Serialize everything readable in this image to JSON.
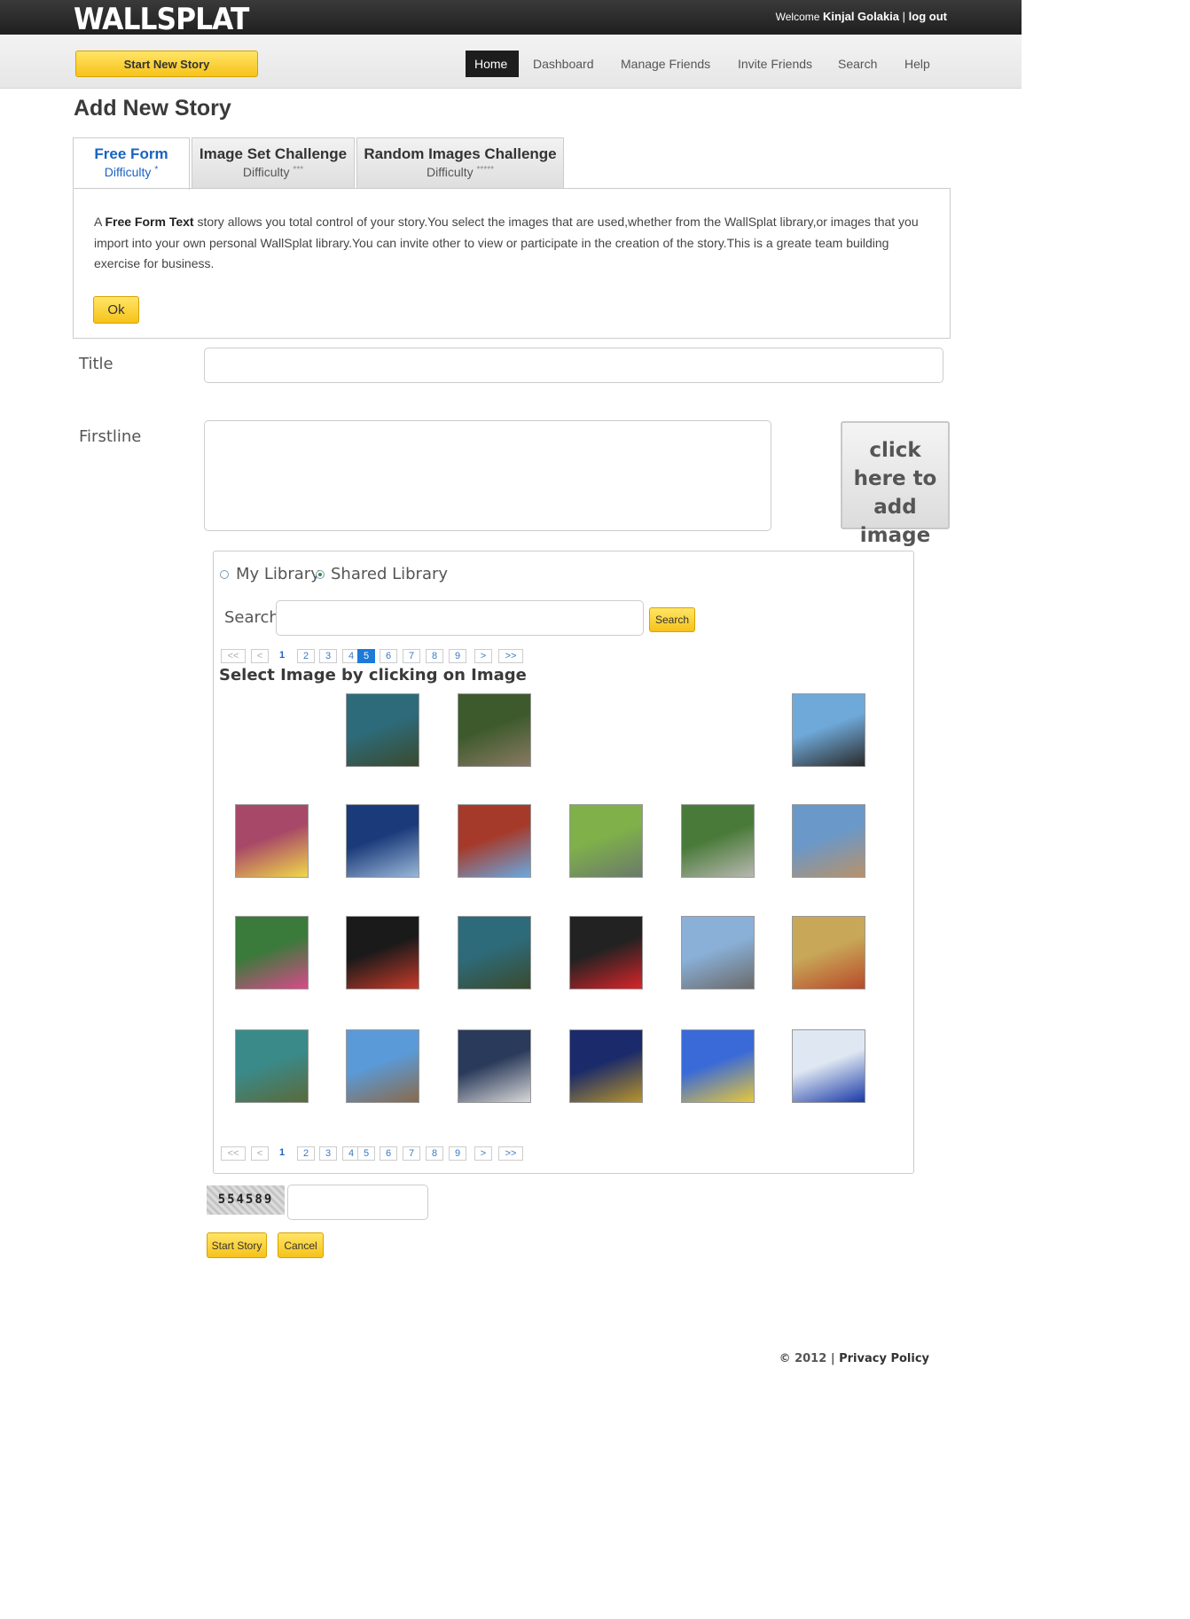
{
  "header": {
    "logo": "WALLSPLAT",
    "welcome": "Welcome",
    "user_name": "Kinjal Golakia",
    "separator": "|",
    "logout": "log out"
  },
  "nav": {
    "start_new_story": "Start New Story",
    "items": [
      "Home",
      "Dashboard",
      "Manage Friends",
      "Invite Friends",
      "Search",
      "Help"
    ],
    "active": "Home"
  },
  "page_title": "Add New Story",
  "tabs": [
    {
      "title": "Free Form",
      "difficulty": "Difficulty",
      "stars": "*"
    },
    {
      "title": "Image Set Challenge",
      "difficulty": "Difficulty",
      "stars": "***"
    },
    {
      "title": "Random Images Challenge",
      "difficulty": "Difficulty",
      "stars": "*****"
    }
  ],
  "description": {
    "prefix": "A ",
    "bold": "Free Form Text",
    "text": " story allows you total control of your story.You select the images that are used,whether from the WallSplat library,or images that you import into your own personal WallSplat library.You can invite other to view or participate in the creation of the story.This is a greate team building exercise for business.",
    "ok_label": "Ok"
  },
  "form": {
    "title_label": "Title",
    "title_value": "",
    "firstline_label": "Firstline",
    "firstline_value": "",
    "add_image_label": "click here to add image"
  },
  "library": {
    "my_library": "My Library",
    "shared_library": "Shared Library",
    "selected": "Shared Library",
    "search_label": "Search",
    "search_value": "",
    "search_button": "Search",
    "select_title": "Select Image by clicking on Image",
    "pager": [
      "<<",
      "<",
      "1",
      "2",
      "3",
      "4",
      "5",
      "6",
      "7",
      "8",
      "9",
      ">",
      ">>"
    ],
    "pager_top_current": "5",
    "pager_bottom_current": "1",
    "images": [
      {
        "name": "blank-image",
        "colors": [
          "#ffffff",
          "#ffffff"
        ]
      },
      {
        "name": "bronx-zoo-gate-image",
        "colors": [
          "#2d6b7a",
          "#3a4a2e"
        ]
      },
      {
        "name": "park-crowd-image",
        "colors": [
          "#3d5a2c",
          "#8a7a62"
        ]
      },
      {
        "name": "blank-image",
        "colors": [
          "#ffffff",
          "#ffffff"
        ]
      },
      {
        "name": "blank-image",
        "colors": [
          "#ffffff",
          "#ffffff"
        ]
      },
      {
        "name": "fan-portrait-image",
        "colors": [
          "#6fa9d9",
          "#2a2a2a"
        ]
      },
      {
        "name": "street-crowd-image",
        "colors": [
          "#a84868",
          "#f0d84a"
        ]
      },
      {
        "name": "train-image",
        "colors": [
          "#1a3a7a",
          "#9ab8d8"
        ]
      },
      {
        "name": "fire-station-image",
        "colors": [
          "#a63a2a",
          "#6aa8e0"
        ]
      },
      {
        "name": "rowing-image",
        "colors": [
          "#7fb04a",
          "#6a7a6a"
        ]
      },
      {
        "name": "stadium-aerial-image",
        "colors": [
          "#4a7a3a",
          "#b8b8b0"
        ]
      },
      {
        "name": "beach-image",
        "colors": [
          "#6a98c8",
          "#b8926a"
        ]
      },
      {
        "name": "garden-flowers-image",
        "colors": [
          "#3a7a3a",
          "#d84a8a"
        ]
      },
      {
        "name": "bronx-tale-poster-image",
        "colors": [
          "#1a1a1a",
          "#c83a2a"
        ]
      },
      {
        "name": "bronx-zoo-gate-image",
        "colors": [
          "#2d6b7a",
          "#3a4a2e"
        ]
      },
      {
        "name": "born-in-the-bronx-image",
        "colors": [
          "#222222",
          "#d8242a"
        ]
      },
      {
        "name": "stadium-facade-image",
        "colors": [
          "#8ab0d8",
          "#6a6a6a"
        ]
      },
      {
        "name": "museum-building-image",
        "colors": [
          "#c8a858",
          "#b84a2a"
        ]
      },
      {
        "name": "bronx-zoo-sign-image",
        "colors": [
          "#3a8a8a",
          "#5a6a3a"
        ]
      },
      {
        "name": "campus-building-image",
        "colors": [
          "#5a9ad8",
          "#8a6a4a"
        ]
      },
      {
        "name": "police-motorcycle-image",
        "colors": [
          "#2a3a5a",
          "#d8d8d8"
        ]
      },
      {
        "name": "police-badge-image",
        "colors": [
          "#1a2a6a",
          "#b8942a"
        ]
      },
      {
        "name": "cartoon-police-image",
        "colors": [
          "#3a6ad8",
          "#e8c83a"
        ]
      },
      {
        "name": "blue-figurine-image",
        "colors": [
          "#dfe8f2",
          "#1a3aa8"
        ]
      }
    ]
  },
  "captcha": {
    "code": "554589",
    "value": ""
  },
  "actions": {
    "start": "Start Story",
    "cancel": "Cancel"
  },
  "footer": {
    "copyright": "© 2012",
    "separator": "|",
    "privacy": "Privacy Policy"
  }
}
